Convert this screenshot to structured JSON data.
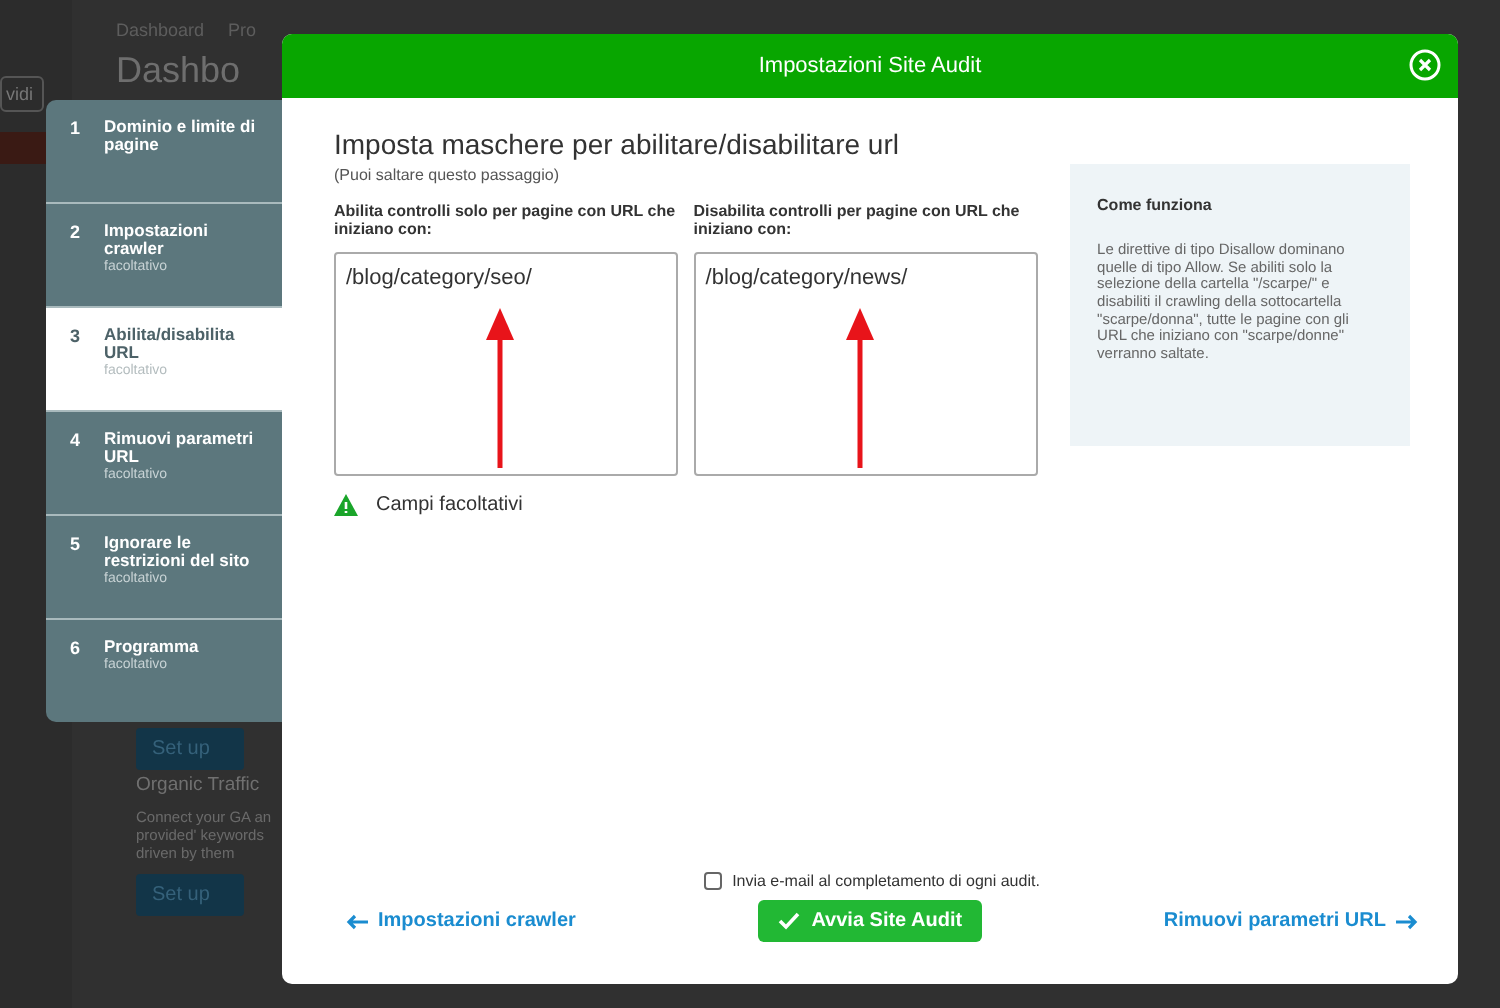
{
  "background_page": {
    "breadcrumb": [
      "Dashboard",
      "Pro"
    ],
    "heading": "Dashbo",
    "side_button": "vidi",
    "cards": [
      {
        "button": "Set up"
      },
      {
        "title": "Organic Traffic",
        "text": "Connect your GA an\nprovided' keywords\ndriven by them",
        "button": "Set up"
      }
    ]
  },
  "steps": [
    {
      "number": "1",
      "title": "Dominio e limite di pagine",
      "selected": false
    },
    {
      "number": "2",
      "title": "Impostazioni crawler",
      "subtitle": "facoltativo",
      "selected": false
    },
    {
      "number": "3",
      "title": "Abilita/disabilita URL",
      "subtitle": "facoltativo",
      "selected": true
    },
    {
      "number": "4",
      "title": "Rimuovi parametri URL",
      "subtitle": "facoltativo",
      "selected": false
    },
    {
      "number": "5",
      "title": "Ignorare le restrizioni del sito",
      "subtitle": "facoltativo",
      "selected": false
    },
    {
      "number": "6",
      "title": "Programma",
      "subtitle": "facoltativo",
      "selected": false
    }
  ],
  "modal": {
    "title": "Impostazioni Site Audit",
    "heading": "Imposta maschere per abilitare/disabilitare url",
    "subheading": "(Puoi saltare questo passaggio)",
    "fields": [
      {
        "label": "Abilita controlli solo per pagine con URL che iniziano con:",
        "value": "/blog/category/seo/"
      },
      {
        "label": "Disabilita controlli per pagine con URL che iniziano con:",
        "value": "/blog/category/news/"
      }
    ],
    "help": {
      "title": "Come funziona",
      "text": "Le direttive di tipo Disallow dominano quelle di tipo Allow. Se abiliti solo la selezione della cartella \"/scarpe/\" e disabiliti il crawling della sottocartella \"scarpe/donna\", tutte le pagine con gli URL che iniziano con \"scarpe/donne\" verranno saltate."
    },
    "warning": "Campi facoltativi",
    "email_checkbox": {
      "label": "Invia e-mail al completamento di ogni audit.",
      "checked": false
    },
    "back_link": "Impostazioni crawler",
    "start_button": "Avvia Site Audit",
    "next_link": "Rimuovi parametri URL"
  }
}
